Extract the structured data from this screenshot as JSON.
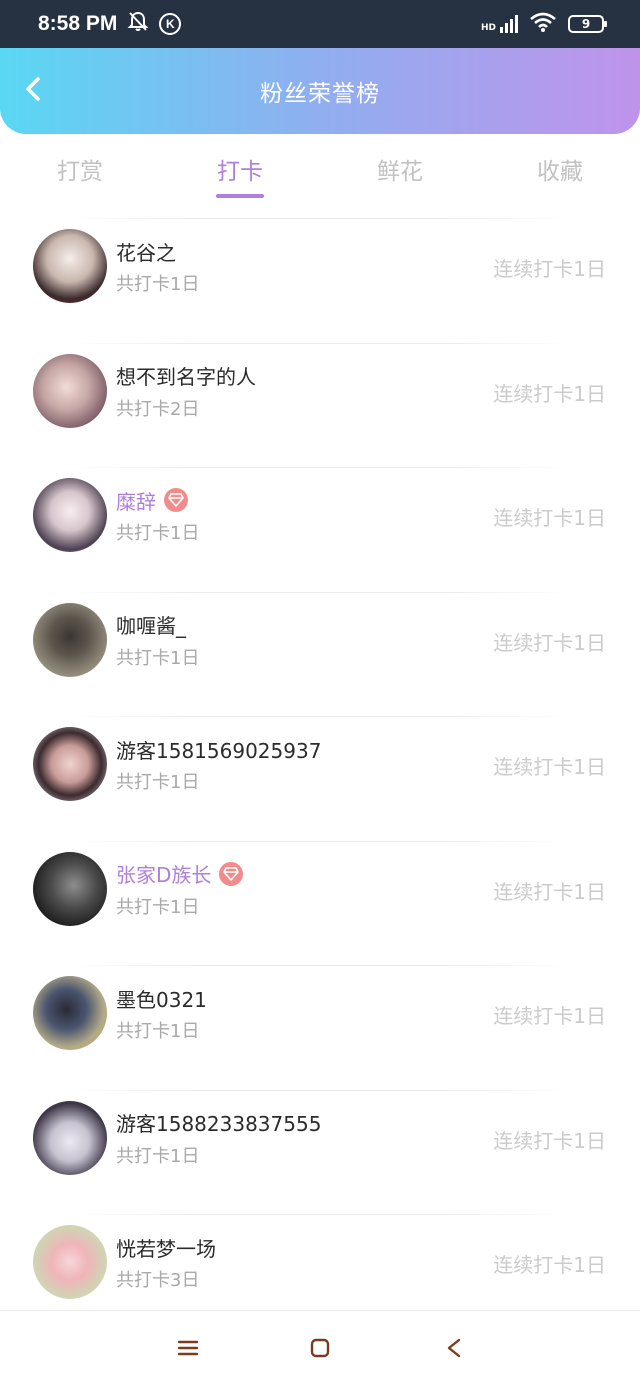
{
  "status_bar": {
    "time": "8:58 PM",
    "k_label": "K",
    "hd_label": "HD",
    "battery": "9",
    "icons": [
      "bell-off-icon",
      "k-circle-icon",
      "signal-icon",
      "wifi-icon",
      "battery-icon"
    ]
  },
  "header": {
    "title": "粉丝荣誉榜",
    "back_icon": "chevron-left-icon",
    "gradient": [
      "#5ad7f3",
      "#bf93eb"
    ]
  },
  "tabs": [
    {
      "label": "打赏",
      "active": false
    },
    {
      "label": "打卡",
      "active": true
    },
    {
      "label": "鲜花",
      "active": false
    },
    {
      "label": "收藏",
      "active": false
    }
  ],
  "colors": {
    "accent": "#b07fdd",
    "vip_badge": "#f28c8c"
  },
  "fans": [
    {
      "name": "花谷之",
      "vip": false,
      "subtitle": "共打卡1日",
      "streak": "连续打卡1日"
    },
    {
      "name": "想不到名字的人",
      "vip": false,
      "subtitle": "共打卡2日",
      "streak": "连续打卡1日"
    },
    {
      "name": "糜辞",
      "vip": true,
      "subtitle": "共打卡1日",
      "streak": "连续打卡1日"
    },
    {
      "name": "咖喱酱_",
      "vip": false,
      "subtitle": "共打卡1日",
      "streak": "连续打卡1日"
    },
    {
      "name": "游客1581569025937",
      "vip": false,
      "subtitle": "共打卡1日",
      "streak": "连续打卡1日"
    },
    {
      "name": "张家D族长",
      "vip": true,
      "subtitle": "共打卡1日",
      "streak": "连续打卡1日"
    },
    {
      "name": "墨色0321",
      "vip": false,
      "subtitle": "共打卡1日",
      "streak": "连续打卡1日"
    },
    {
      "name": "游客1588233837555",
      "vip": false,
      "subtitle": "共打卡1日",
      "streak": "连续打卡1日"
    },
    {
      "name": "恍若梦一场",
      "vip": false,
      "subtitle": "共打卡3日",
      "streak": "连续打卡1日"
    }
  ],
  "nav_bar": {
    "icons": [
      "menu-icon",
      "home-square-icon",
      "back-triangle-icon"
    ]
  }
}
